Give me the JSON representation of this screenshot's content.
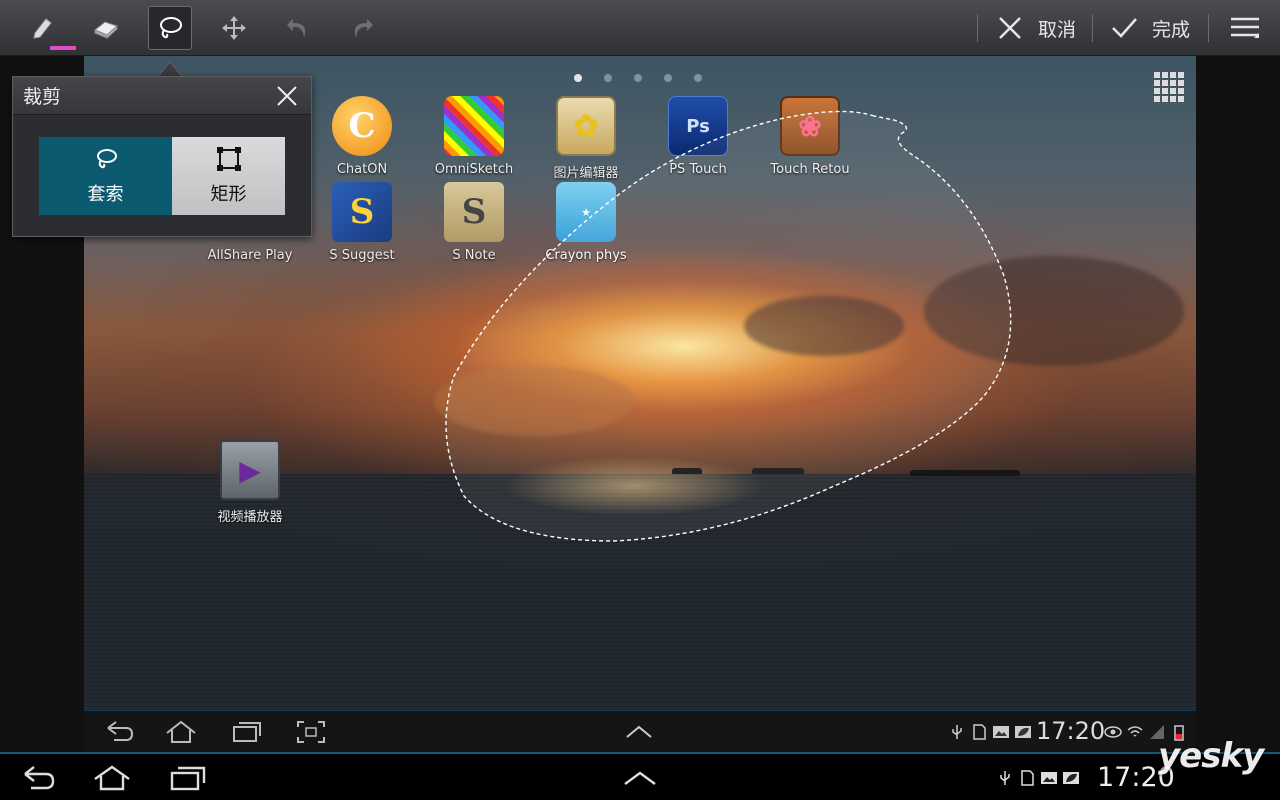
{
  "toolbar": {
    "tools": [
      {
        "name": "pen-tool",
        "icon": "pen-icon",
        "active": false
      },
      {
        "name": "eraser-tool",
        "icon": "eraser-icon",
        "active": false
      },
      {
        "name": "lasso-tool",
        "icon": "lasso-icon",
        "active": true
      },
      {
        "name": "move-tool",
        "icon": "move-icon",
        "active": false
      },
      {
        "name": "undo-tool",
        "icon": "undo-icon",
        "disabled": true
      },
      {
        "name": "redo-tool",
        "icon": "redo-icon",
        "disabled": true
      }
    ],
    "pen_color": "#e24cc8",
    "cancel_label": "取消",
    "done_label": "完成"
  },
  "crop_popup": {
    "title": "裁剪",
    "options": [
      {
        "label": "套索",
        "icon": "lasso-icon",
        "selected": true
      },
      {
        "label": "矩形",
        "icon": "rectangle-select-icon",
        "selected": false
      }
    ],
    "accent": "#0b5a70"
  },
  "home_screen": {
    "page_indicator": {
      "count": 5,
      "current": 1
    },
    "apps": [
      {
        "label": "ChatON",
        "icon": "chaton-icon"
      },
      {
        "label": "OmniSketch",
        "icon": "omnisketch-icon"
      },
      {
        "label": "图片编辑器",
        "icon": "photo-editor-icon"
      },
      {
        "label": "PS Touch",
        "icon": "ps-touch-icon"
      },
      {
        "label": "Touch Retou",
        "icon": "touch-retouch-icon"
      },
      {
        "label": "AllShare Play",
        "icon": "allshare-play-icon"
      },
      {
        "label": "S Suggest",
        "icon": "s-suggest-icon"
      },
      {
        "label": "S Note",
        "icon": "s-note-icon"
      },
      {
        "label": "Crayon phys",
        "icon": "crayon-physics-icon"
      },
      {
        "label": "视频播放器",
        "icon": "video-player-icon"
      }
    ]
  },
  "inner_status": {
    "time": "17:20"
  },
  "outer_status": {
    "time": "17:20"
  },
  "watermark": "yesky"
}
